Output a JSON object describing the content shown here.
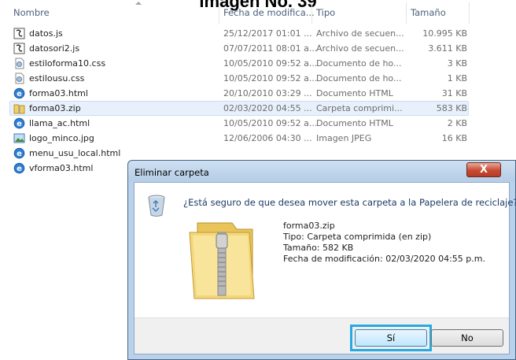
{
  "caption": "Imagen No. 39",
  "columns": {
    "name": "Nombre",
    "date": "Fecha de modifica...",
    "type": "Tipo",
    "size": "Tamaño"
  },
  "files": [
    {
      "name": "datos.js",
      "date": "25/12/2017 01:01 ...",
      "type": "Archivo de secuen...",
      "size": "10.995 KB",
      "icon": "script-file-icon"
    },
    {
      "name": "datosori2.js",
      "date": "07/07/2011 08:01 a...",
      "type": "Archivo de secuen...",
      "size": "3.611 KB",
      "icon": "script-file-icon"
    },
    {
      "name": "estiloforma10.css",
      "date": "10/05/2010 09:52 a...",
      "type": "Documento de ho...",
      "size": "3 KB",
      "icon": "css-file-icon"
    },
    {
      "name": "estilousu.css",
      "date": "10/05/2010 09:52 a...",
      "type": "Documento de ho...",
      "size": "1 KB",
      "icon": "css-file-icon"
    },
    {
      "name": "forma03.html",
      "date": "20/10/2010 03:29 ...",
      "type": "Documento HTML",
      "size": "31 KB",
      "icon": "html-file-icon"
    },
    {
      "name": "forma03.zip",
      "date": "02/03/2020 04:55 ...",
      "type": "Carpeta comprimi...",
      "size": "583 KB",
      "icon": "zip-folder-icon",
      "selected": true
    },
    {
      "name": "llama_ac.html",
      "date": "10/05/2010 09:52 a...",
      "type": "Documento HTML",
      "size": "2 KB",
      "icon": "html-file-icon"
    },
    {
      "name": "logo_minco.jpg",
      "date": "12/06/2006 04:30 ...",
      "type": "Imagen JPEG",
      "size": "16 KB",
      "icon": "image-file-icon"
    },
    {
      "name": "menu_usu_local.html",
      "date": "",
      "type": "",
      "size": "",
      "icon": "html-file-icon"
    },
    {
      "name": "vforma03.html",
      "date": "",
      "type": "",
      "size": "",
      "icon": "html-file-icon"
    }
  ],
  "dialog": {
    "title": "Eliminar carpeta",
    "close_label": "X",
    "question": "¿Está seguro de que desea mover esta carpeta a la Papelera de reciclaje?",
    "file_name": "forma03.zip",
    "file_type": "Tipo: Carpeta comprimida (en zip)",
    "file_size": "Tamaño: 582 KB",
    "file_modified": "Fecha de modificación: 02/03/2020 04:55 p.m.",
    "yes_label": "Sí",
    "no_label": "No"
  },
  "colors": {
    "focus_ring": "#27a9e1",
    "selection": "#e8f1fb",
    "close_button": "#c74a33"
  }
}
